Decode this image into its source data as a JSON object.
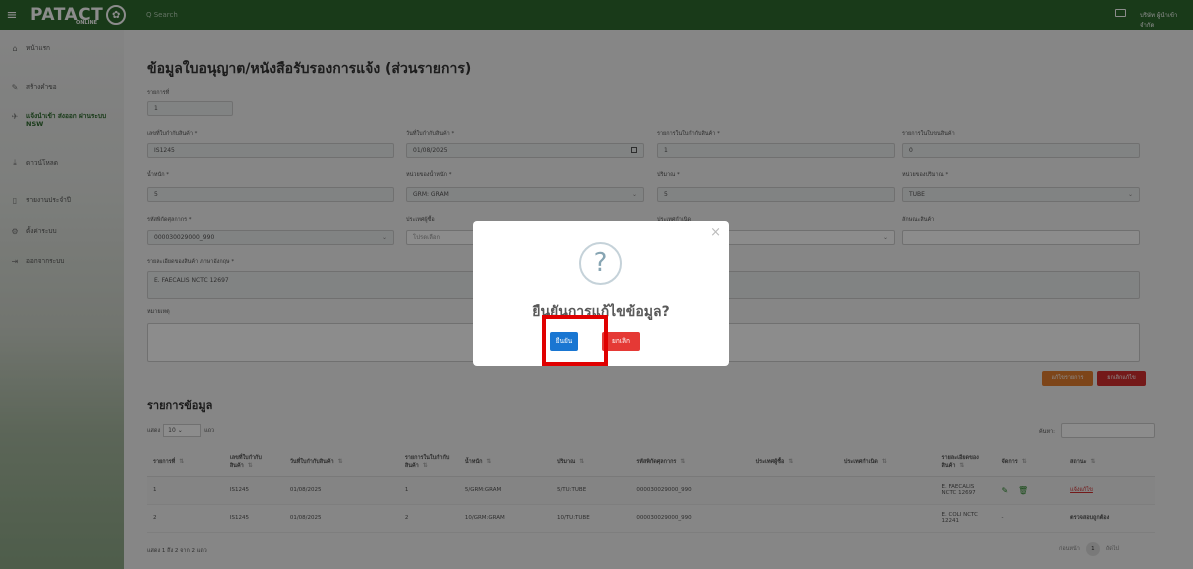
{
  "topbar": {
    "logo": "PATACT",
    "logo_sub": "ONLINE",
    "search_placeholder": "Q  Search",
    "user": "บริษัท ผู้นำเข้า จำกัด"
  },
  "sidebar": {
    "items": [
      {
        "icon": "home-icon",
        "label": "หน้าแรก"
      },
      {
        "icon": "pencil-icon",
        "label": "สร้างคำขอ"
      },
      {
        "icon": "plane-icon",
        "label": "แจ้งนำเข้า ส่งออก ผ่านระบบ NSW"
      },
      {
        "icon": "download-icon",
        "label": "ดาวน์โหลด"
      },
      {
        "icon": "document-icon",
        "label": "รายงานประจำปี"
      },
      {
        "icon": "gear-icon",
        "label": "ตั้งค่าระบบ"
      },
      {
        "icon": "logout-icon",
        "label": "ออกจากระบบ"
      }
    ]
  },
  "form": {
    "title": "ข้อมูลใบอนุญาต/หนังสือรับรองการแจ้ง (ส่วนรายการ)",
    "item_no_label": "รายการที่",
    "item_no_value": "1",
    "invoice_no_label": "เลขที่ใบกำกับสินค้า *",
    "invoice_no_value": "IS1245",
    "invoice_date_label": "วันที่ใบกำกับสินค้า *",
    "invoice_date_value": "01/08/2025",
    "invoice_item_label": "รายการในใบกำกับสินค้า *",
    "invoice_item_value": "1",
    "packing_item_label": "รายการในใบขนสินค้า",
    "packing_item_value": "0",
    "weight_label": "น้ำหนัก *",
    "weight_value": "5",
    "weight_unit_label": "หน่วยของน้ำหนัก *",
    "weight_unit_value": "GRM: GRAM",
    "qty_label": "ปริมาณ *",
    "qty_value": "5",
    "qty_unit_label": "หน่วยของปริมาณ *",
    "qty_unit_value": "TUBE",
    "tariff_label": "รหัสพิกัดศุลกากร *",
    "tariff_value": "000030029000_990",
    "buyer_country_label": "ประเทศผู้ซื้อ",
    "buyer_country_placeholder": "โปรดเลือก",
    "origin_country_label": "ประเทศกำเนิด",
    "product_feature_label": "ลักษณะสินค้า",
    "description_label": "รายละเอียดของสินค้า ภาษาอังกฤษ *",
    "description_value": "E. FAECALIS NCTC 12697",
    "remark_label": "หมายเหตุ",
    "edit_button": "แก้ไขรายการ",
    "cancel_edit_button": "ยกเลิกแก้ไข"
  },
  "list": {
    "title": "รายการข้อมูล",
    "show_prefix": "แสดง",
    "page_size": "10",
    "show_suffix": "แถว",
    "search_label": "ค้นหา:",
    "columns": [
      "รายการที่",
      "เลขที่ใบกำกับสินค้า",
      "วันที่ใบกำกับสินค้า",
      "รายการในใบกำกับสินค้า",
      "น้ำหนัก",
      "ปริมาณ",
      "รหัสพิกัดศุลกากร",
      "ประเทศผู้ซื้อ",
      "ประเทศกำเนิด",
      "รายละเอียดของสินค้า",
      "จัดการ",
      "สถานะ"
    ],
    "rows": [
      {
        "no": "1",
        "invoice": "IS1245",
        "date": "01/08/2025",
        "item": "1",
        "weight": "5/GRM:GRAM",
        "qty": "5/TU:TUBE",
        "tariff": "000030029000_990",
        "buyer": "",
        "origin": "",
        "desc": "E. FAECALIS NCTC 12697",
        "manage": "",
        "status": "แจ้งแก้ไข"
      },
      {
        "no": "2",
        "invoice": "IS1245",
        "date": "01/08/2025",
        "item": "2",
        "weight": "10/GRM:GRAM",
        "qty": "10/TU:TUBE",
        "tariff": "000030029000_990",
        "buyer": "",
        "origin": "",
        "desc": "E. COLI NCTC 12241",
        "manage": "-",
        "status": "ตรวจสอบถูกต้อง"
      }
    ],
    "footer_info": "แสดง 1 ถึง 2 จาก 2 แถว",
    "prev": "ก่อนหน้า",
    "page": "1",
    "next": "ถัดไป"
  },
  "modal": {
    "icon": "question-icon",
    "title": "ยืนยันการแก้ไขข้อมูล?",
    "confirm": "ยืนยัน",
    "cancel": "ยกเลิก",
    "close": "×"
  }
}
